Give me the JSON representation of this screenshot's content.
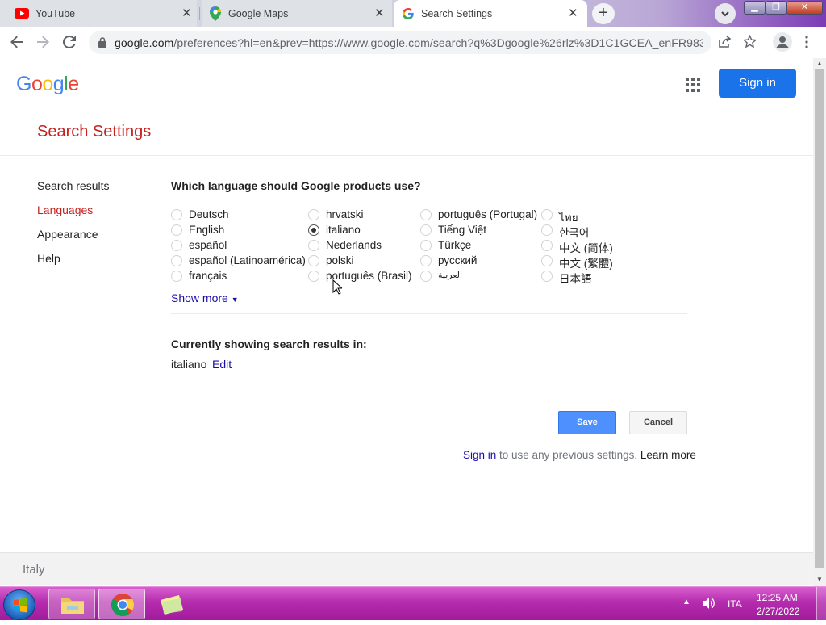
{
  "tabs": [
    {
      "title": "YouTube",
      "icon": "youtube-icon"
    },
    {
      "title": "Google Maps",
      "icon": "google-maps-icon"
    },
    {
      "title": "Search Settings",
      "icon": "google-g-icon",
      "active": true
    }
  ],
  "address_bar": {
    "host": "google.com",
    "path": "/preferences?hl=en&prev=https://www.google.com/search?q%3Dgoogle%26rlz%3D1C1GCEA_enFR983F..."
  },
  "header": {
    "logo": "Google",
    "signin_label": "Sign in"
  },
  "page_title": "Search Settings",
  "sidebar": {
    "items": [
      {
        "label": "Search results"
      },
      {
        "label": "Languages",
        "active": true
      },
      {
        "label": "Appearance"
      },
      {
        "label": "Help"
      }
    ]
  },
  "languages": {
    "question": "Which language should Google products use?",
    "selected": "italiano",
    "columns": [
      [
        "Deutsch",
        "English",
        "español",
        "español (Latinoamérica)",
        "français"
      ],
      [
        "hrvatski",
        "italiano",
        "Nederlands",
        "polski",
        "português (Brasil)"
      ],
      [
        "português (Portugal)",
        "Tiếng Việt",
        "Türkçe",
        "русский",
        "العربية"
      ],
      [
        "ไทย",
        "한국어",
        "中文 (简体)",
        "中文 (繁體)",
        "日本語"
      ]
    ],
    "show_more": "Show more"
  },
  "current": {
    "heading": "Currently showing search results in:",
    "language": "italiano",
    "edit_label": "Edit"
  },
  "actions": {
    "save_label": "Save",
    "cancel_label": "Cancel"
  },
  "signin_note": {
    "link": "Sign in",
    "text": " to use any previous settings. ",
    "learn_more": "Learn more"
  },
  "footer": {
    "country": "Italy"
  },
  "taskbar": {
    "language": "ITA",
    "time": "12:25 AM",
    "date": "2/27/2022"
  },
  "colors": {
    "accent_red": "#c5221f",
    "signin_blue": "#1a73e8",
    "save_blue": "#4d90fe",
    "link_blue": "#1a0dab",
    "taskbar": "#b52cae"
  }
}
